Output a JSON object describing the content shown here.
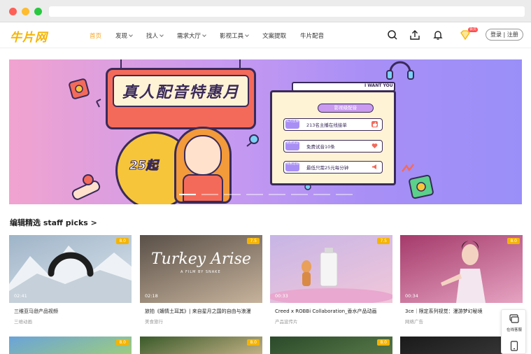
{
  "header": {
    "logo": "牛片网",
    "nav": [
      {
        "label": "首页",
        "dropdown": false,
        "active": true
      },
      {
        "label": "发现",
        "dropdown": true,
        "active": false
      },
      {
        "label": "找人",
        "dropdown": true,
        "active": false
      },
      {
        "label": "需求大厅",
        "dropdown": true,
        "active": false
      },
      {
        "label": "影视工具",
        "dropdown": true,
        "active": false
      },
      {
        "label": "文案提取",
        "dropdown": false,
        "active": false
      },
      {
        "label": "牛片配音",
        "dropdown": false,
        "active": false
      }
    ],
    "vip_badge": "会员",
    "login_label": "登录 | 注册",
    "icons": [
      "search-icon",
      "upload-icon",
      "bell-icon",
      "vip-diamond-icon"
    ]
  },
  "banner": {
    "title": "真人配音特惠月",
    "price": "25起",
    "panel_tab": "I WANT YOU",
    "panel_head": "影视级配音",
    "rows": [
      {
        "tag": "实力主播",
        "text": "213名主播在线接单",
        "icon": "thumb-up-icon"
      },
      {
        "tag": "免费试音",
        "text": "免费试音10条",
        "icon": "heart-icon"
      },
      {
        "tag": "特惠活动",
        "text": "最低只需25元每分钟",
        "icon": "megaphone-icon"
      }
    ],
    "slides": 8,
    "active_slide": 0
  },
  "section": {
    "title": "编辑精选 staff picks >"
  },
  "cards": [
    {
      "score": "8.0",
      "duration": "02:41",
      "title": "三维亚马逊产品视频",
      "category": "三维动画",
      "colors": [
        "#9fb4c8",
        "#dfe7ee"
      ]
    },
    {
      "score": "7.5",
      "duration": "02:18",
      "title": "旅拍《媚情土耳其》| 来自星月之国的自由与浪漫",
      "category": "美食旅行",
      "thumb_text": "Turkey Arise",
      "thumb_sub": "A FILM BY SNAKE",
      "colors": [
        "#5a5048",
        "#c7b39c"
      ]
    },
    {
      "score": "7.5",
      "duration": "00:33",
      "title": "Creed x ROBBi Collaboration_香水产品动画",
      "category": "产品宣传片",
      "colors": [
        "#c7b5e6",
        "#f2c7d9"
      ]
    },
    {
      "score": "8.0",
      "duration": "00:34",
      "title": "3ce｜限定系列视觉：漫游梦幻秘境",
      "category": "网络广告",
      "colors": [
        "#a53a6a",
        "#e6a3c2"
      ]
    }
  ],
  "cards_row2": [
    {
      "score": "8.0",
      "colors": [
        "#6aa3d9",
        "#9fcf7a"
      ]
    },
    {
      "score": "8.0",
      "colors": [
        "#3a5a2a",
        "#c9b58a"
      ]
    },
    {
      "score": "8.0",
      "colors": [
        "#2a4a2a",
        "#5a7a4a"
      ]
    },
    {
      "score": "",
      "colors": [
        "#1a1a1a",
        "#3a3a3a"
      ]
    }
  ],
  "side_widget": {
    "label": "在线客服",
    "icons": [
      "chat-icon",
      "phone-icon"
    ]
  },
  "colors": {
    "accent": "#f5a623",
    "score_badge": "#f5b400",
    "banner_dark": "#3a2a5a"
  }
}
